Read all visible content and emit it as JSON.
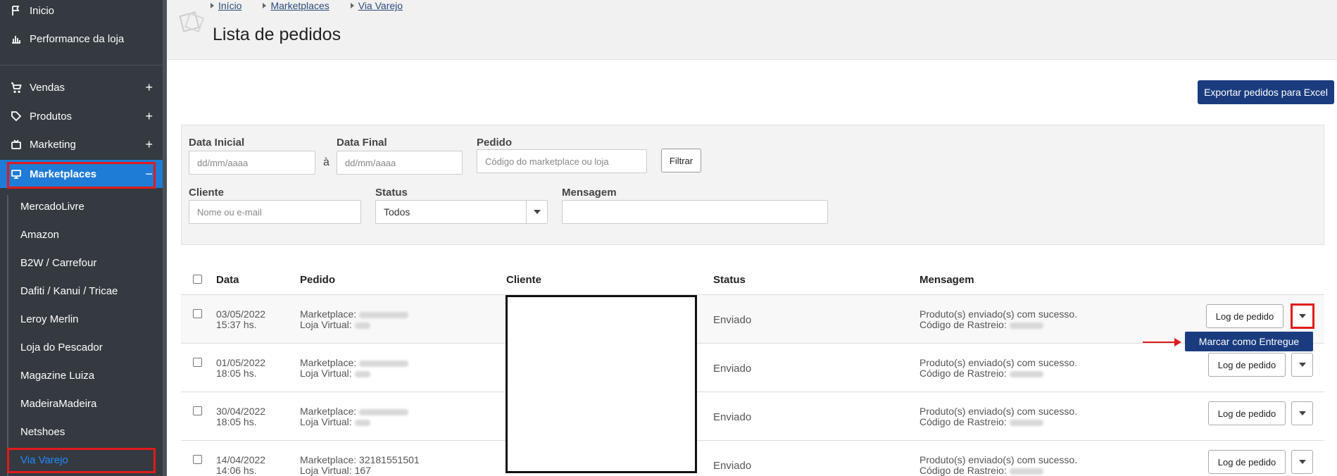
{
  "sidebar": {
    "top_items": [
      {
        "label": "Inicio",
        "icon": "flag-icon"
      },
      {
        "label": "Performance da loja",
        "icon": "bar-chart-icon"
      }
    ],
    "items": [
      {
        "label": "Vendas",
        "icon": "cart-icon",
        "toggle": "+"
      },
      {
        "label": "Produtos",
        "icon": "tag-icon",
        "toggle": "+"
      },
      {
        "label": "Marketing",
        "icon": "tv-icon",
        "toggle": "+"
      },
      {
        "label": "Marketplaces",
        "icon": "monitor-icon",
        "toggle": "−"
      }
    ],
    "submenu": [
      "MercadoLivre",
      "Amazon",
      "B2W / Carrefour",
      "Dafiti / Kanui / Tricae",
      "Leroy Merlin",
      "Loja do Pescador",
      "Magazine Luiza",
      "MadeiraMadeira",
      "Netshoes",
      "Via Varejo"
    ]
  },
  "breadcrumb": [
    "Início",
    "Marketplaces",
    "Via Varejo"
  ],
  "page_title": "Lista de pedidos",
  "export_button": "Exportar pedidos para Excel",
  "filters": {
    "data_inicial_label": "Data Inicial",
    "data_inicial_placeholder": "dd/mm/aaaa",
    "separator": "à",
    "data_final_label": "Data Final",
    "data_final_placeholder": "dd/mm/aaaa",
    "pedido_label": "Pedido",
    "pedido_placeholder": "Código do marketplace ou loja",
    "filter_button": "Filtrar",
    "cliente_label": "Cliente",
    "cliente_placeholder": "Nome ou e-mail",
    "status_label": "Status",
    "status_value": "Todos",
    "mensagem_label": "Mensagem",
    "mensagem_value": ""
  },
  "table": {
    "headers": [
      "Data",
      "Pedido",
      "Cliente",
      "Status",
      "Mensagem"
    ],
    "rows": [
      {
        "date": "03/05/2022",
        "time": "15:37 hs.",
        "marketplace_label": "Marketplace:",
        "loja_label": "Loja Virtual:",
        "status": "Enviado",
        "msg1": "Produto(s) enviado(s) com sucesso.",
        "msg2": "Código de Rastreio:"
      },
      {
        "date": "01/05/2022",
        "time": "18:05 hs.",
        "marketplace_label": "Marketplace:",
        "loja_label": "Loja Virtual:",
        "status": "Enviado",
        "msg1": "Produto(s) enviado(s) com sucesso.",
        "msg2": "Código de Rastreio:"
      },
      {
        "date": "30/04/2022",
        "time": "18:05 hs.",
        "marketplace_label": "Marketplace:",
        "loja_label": "Loja Virtual:",
        "status": "Enviado",
        "msg1": "Produto(s) enviado(s) com sucesso.",
        "msg2": "Código de Rastreio:"
      },
      {
        "date": "14/04/2022",
        "time": "14:06 hs.",
        "marketplace_label": "Marketplace: 32181551501",
        "loja_label": "Loja Virtual: 167",
        "status": "Enviado",
        "msg1": "Produto(s) enviado(s) com sucesso.",
        "msg2": "Código de Rastreio:"
      }
    ],
    "log_button": "Log de pedido",
    "dropdown_item": "Marcar como Entregue"
  },
  "colors": {
    "sidebar_bg": "#343a40",
    "accent": "#1e7bd6",
    "primary_button": "#1a3c7f",
    "annotation_red": "#e01b1b"
  }
}
